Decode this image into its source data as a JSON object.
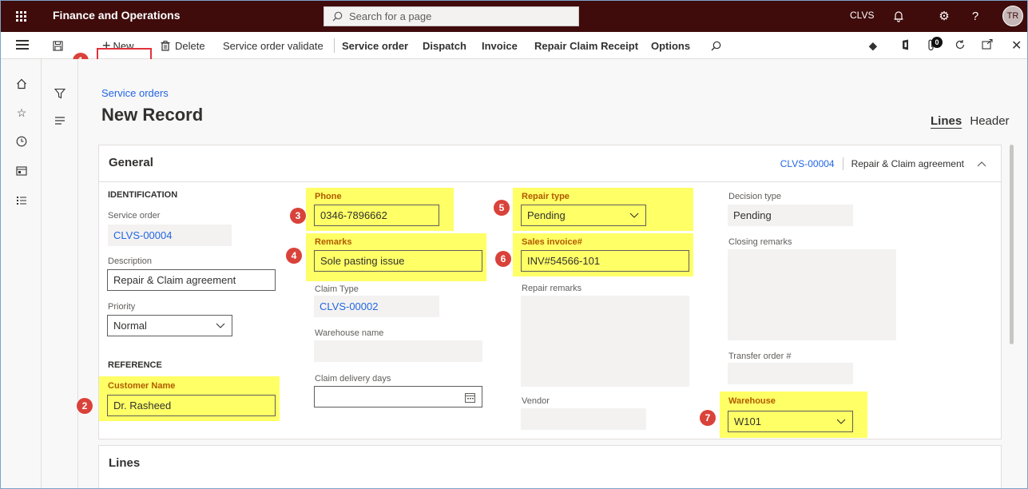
{
  "topbar": {
    "app_title": "Finance and Operations",
    "search_placeholder": "Search for a page",
    "company": "CLVS",
    "avatar_initials": "TR"
  },
  "actions": {
    "new": "New",
    "delete": "Delete",
    "service_order_validate": "Service order validate",
    "service_order": "Service order",
    "dispatch": "Dispatch",
    "invoice": "Invoice",
    "repair_claim_receipt": "Repair Claim Receipt",
    "options": "Options",
    "attachments_count": "0"
  },
  "breadcrumb": "Service orders",
  "page_title": "New Record",
  "view_tabs": {
    "lines": "Lines",
    "header": "Header"
  },
  "general": {
    "title": "General",
    "summary_id": "CLVS-00004",
    "summary_desc": "Repair & Claim agreement"
  },
  "fields": {
    "identification": "IDENTIFICATION",
    "service_order_label": "Service order",
    "service_order_value": "CLVS-00004",
    "description_label": "Description",
    "description_value": "Repair & Claim agreement",
    "priority_label": "Priority",
    "priority_value": "Normal",
    "reference": "REFERENCE",
    "customer_name_label": "Customer Name",
    "customer_name_value": "Dr. Rasheed",
    "phone_label": "Phone",
    "phone_value": "0346-7896662",
    "remarks_label": "Remarks",
    "remarks_value": "Sole pasting issue",
    "claim_type_label": "Claim Type",
    "claim_type_value": "CLVS-00002",
    "warehouse_name_label": "Warehouse name",
    "claim_delivery_days_label": "Claim delivery days",
    "repair_type_label": "Repair type",
    "repair_type_value": "Pending",
    "sales_invoice_label": "Sales invoice#",
    "sales_invoice_value": "INV#54566-101",
    "repair_remarks_label": "Repair remarks",
    "vendor_label": "Vendor",
    "decision_type_label": "Decision type",
    "decision_type_value": "Pending",
    "closing_remarks_label": "Closing remarks",
    "transfer_order_label": "Transfer order #",
    "warehouse_label": "Warehouse",
    "warehouse_value": "W101"
  },
  "lines_title": "Lines",
  "callouts": [
    "1",
    "2",
    "3",
    "4",
    "5",
    "6",
    "7"
  ],
  "colors": {
    "topbar": "#3f0b0b",
    "highlight": "#ffff66",
    "callout": "#d9423a",
    "link": "#2266e3"
  }
}
